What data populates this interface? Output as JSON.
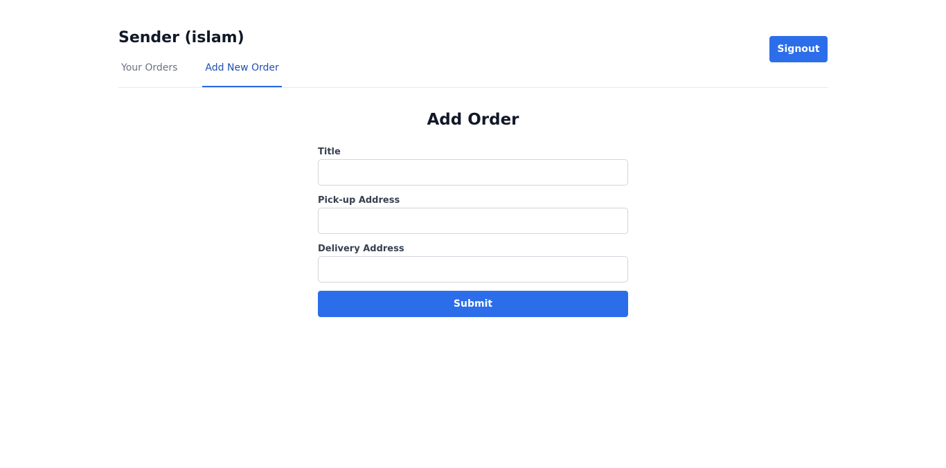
{
  "header": {
    "title": "Sender (islam)",
    "signout_label": "Signout"
  },
  "tabs": [
    {
      "label": "Your Orders",
      "active": false
    },
    {
      "label": "Add New Order",
      "active": true
    }
  ],
  "form": {
    "title": "Add Order",
    "fields": [
      {
        "label": "Title",
        "value": "",
        "placeholder": ""
      },
      {
        "label": "Pick-up Address",
        "value": "",
        "placeholder": ""
      },
      {
        "label": "Delivery Address",
        "value": "",
        "placeholder": ""
      }
    ],
    "submit_label": "Submit"
  },
  "colors": {
    "primary": "#2c6eea",
    "active_tab_text": "#1e4fb4",
    "inactive_tab_text": "#6b7280",
    "divider": "#e5e7eb"
  }
}
